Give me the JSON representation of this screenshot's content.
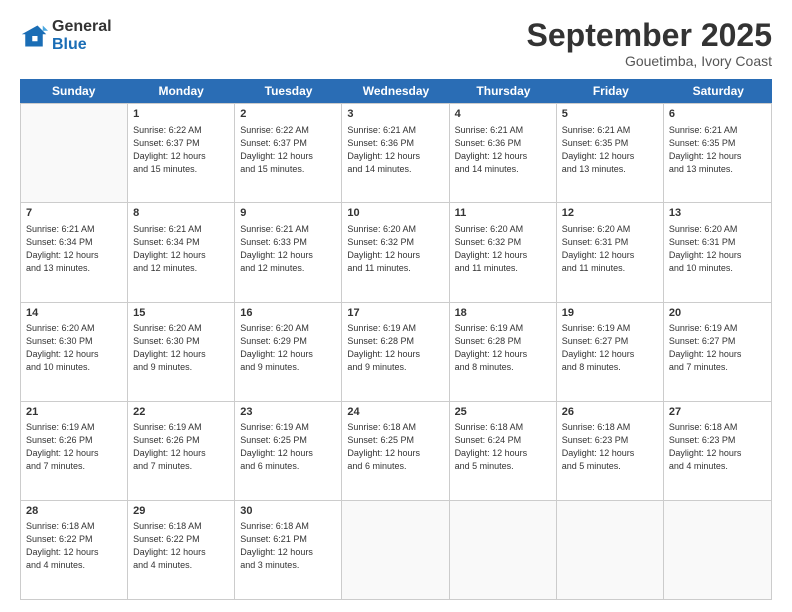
{
  "header": {
    "logo_general": "General",
    "logo_blue": "Blue",
    "month_title": "September 2025",
    "location": "Gouetimba, Ivory Coast"
  },
  "days_of_week": [
    "Sunday",
    "Monday",
    "Tuesday",
    "Wednesday",
    "Thursday",
    "Friday",
    "Saturday"
  ],
  "weeks": [
    [
      {
        "day": "",
        "info": ""
      },
      {
        "day": "1",
        "info": "Sunrise: 6:22 AM\nSunset: 6:37 PM\nDaylight: 12 hours\nand 15 minutes."
      },
      {
        "day": "2",
        "info": "Sunrise: 6:22 AM\nSunset: 6:37 PM\nDaylight: 12 hours\nand 15 minutes."
      },
      {
        "day": "3",
        "info": "Sunrise: 6:21 AM\nSunset: 6:36 PM\nDaylight: 12 hours\nand 14 minutes."
      },
      {
        "day": "4",
        "info": "Sunrise: 6:21 AM\nSunset: 6:36 PM\nDaylight: 12 hours\nand 14 minutes."
      },
      {
        "day": "5",
        "info": "Sunrise: 6:21 AM\nSunset: 6:35 PM\nDaylight: 12 hours\nand 13 minutes."
      },
      {
        "day": "6",
        "info": "Sunrise: 6:21 AM\nSunset: 6:35 PM\nDaylight: 12 hours\nand 13 minutes."
      }
    ],
    [
      {
        "day": "7",
        "info": "Sunrise: 6:21 AM\nSunset: 6:34 PM\nDaylight: 12 hours\nand 13 minutes."
      },
      {
        "day": "8",
        "info": "Sunrise: 6:21 AM\nSunset: 6:34 PM\nDaylight: 12 hours\nand 12 minutes."
      },
      {
        "day": "9",
        "info": "Sunrise: 6:21 AM\nSunset: 6:33 PM\nDaylight: 12 hours\nand 12 minutes."
      },
      {
        "day": "10",
        "info": "Sunrise: 6:20 AM\nSunset: 6:32 PM\nDaylight: 12 hours\nand 11 minutes."
      },
      {
        "day": "11",
        "info": "Sunrise: 6:20 AM\nSunset: 6:32 PM\nDaylight: 12 hours\nand 11 minutes."
      },
      {
        "day": "12",
        "info": "Sunrise: 6:20 AM\nSunset: 6:31 PM\nDaylight: 12 hours\nand 11 minutes."
      },
      {
        "day": "13",
        "info": "Sunrise: 6:20 AM\nSunset: 6:31 PM\nDaylight: 12 hours\nand 10 minutes."
      }
    ],
    [
      {
        "day": "14",
        "info": "Sunrise: 6:20 AM\nSunset: 6:30 PM\nDaylight: 12 hours\nand 10 minutes."
      },
      {
        "day": "15",
        "info": "Sunrise: 6:20 AM\nSunset: 6:30 PM\nDaylight: 12 hours\nand 9 minutes."
      },
      {
        "day": "16",
        "info": "Sunrise: 6:20 AM\nSunset: 6:29 PM\nDaylight: 12 hours\nand 9 minutes."
      },
      {
        "day": "17",
        "info": "Sunrise: 6:19 AM\nSunset: 6:28 PM\nDaylight: 12 hours\nand 9 minutes."
      },
      {
        "day": "18",
        "info": "Sunrise: 6:19 AM\nSunset: 6:28 PM\nDaylight: 12 hours\nand 8 minutes."
      },
      {
        "day": "19",
        "info": "Sunrise: 6:19 AM\nSunset: 6:27 PM\nDaylight: 12 hours\nand 8 minutes."
      },
      {
        "day": "20",
        "info": "Sunrise: 6:19 AM\nSunset: 6:27 PM\nDaylight: 12 hours\nand 7 minutes."
      }
    ],
    [
      {
        "day": "21",
        "info": "Sunrise: 6:19 AM\nSunset: 6:26 PM\nDaylight: 12 hours\nand 7 minutes."
      },
      {
        "day": "22",
        "info": "Sunrise: 6:19 AM\nSunset: 6:26 PM\nDaylight: 12 hours\nand 7 minutes."
      },
      {
        "day": "23",
        "info": "Sunrise: 6:19 AM\nSunset: 6:25 PM\nDaylight: 12 hours\nand 6 minutes."
      },
      {
        "day": "24",
        "info": "Sunrise: 6:18 AM\nSunset: 6:25 PM\nDaylight: 12 hours\nand 6 minutes."
      },
      {
        "day": "25",
        "info": "Sunrise: 6:18 AM\nSunset: 6:24 PM\nDaylight: 12 hours\nand 5 minutes."
      },
      {
        "day": "26",
        "info": "Sunrise: 6:18 AM\nSunset: 6:23 PM\nDaylight: 12 hours\nand 5 minutes."
      },
      {
        "day": "27",
        "info": "Sunrise: 6:18 AM\nSunset: 6:23 PM\nDaylight: 12 hours\nand 4 minutes."
      }
    ],
    [
      {
        "day": "28",
        "info": "Sunrise: 6:18 AM\nSunset: 6:22 PM\nDaylight: 12 hours\nand 4 minutes."
      },
      {
        "day": "29",
        "info": "Sunrise: 6:18 AM\nSunset: 6:22 PM\nDaylight: 12 hours\nand 4 minutes."
      },
      {
        "day": "30",
        "info": "Sunrise: 6:18 AM\nSunset: 6:21 PM\nDaylight: 12 hours\nand 3 minutes."
      },
      {
        "day": "",
        "info": ""
      },
      {
        "day": "",
        "info": ""
      },
      {
        "day": "",
        "info": ""
      },
      {
        "day": "",
        "info": ""
      }
    ]
  ]
}
